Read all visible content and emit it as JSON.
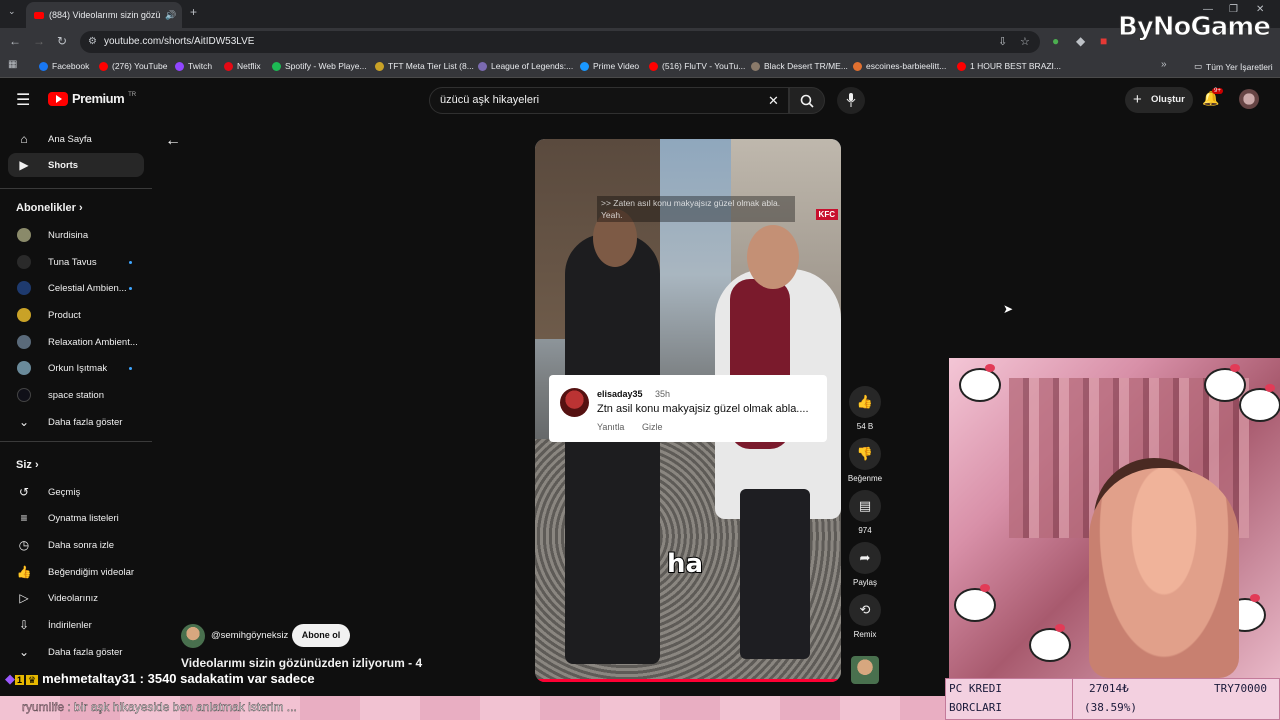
{
  "browser": {
    "tab_title": "(884) Videolarımı sizin gözü",
    "url": "youtube.com/shorts/AitIDW53LVE",
    "bookmarks": [
      "Facebook",
      "(276) YouTube",
      "Twitch",
      "Netflix",
      "Spotify - Web Playe...",
      "TFT Meta Tier List (8...",
      "League of Legends:...",
      "Prime Video",
      "(516) FluTV - YouTu...",
      "Black Desert TR/ME...",
      "escoines-barbieelitt...",
      "1 HOUR BEST BRAZI..."
    ],
    "all_bookmarks": "Tüm Yer İşaretleri"
  },
  "watermark": "ByNoGame",
  "youtube": {
    "logo": "Premium",
    "logo_region": "TR",
    "search_query": "üzücü aşk hikayeleri",
    "create_label": "Oluştur",
    "notif_badge": "9+",
    "sidebar": {
      "home": "Ana Sayfa",
      "shorts": "Shorts",
      "subscriptions_head": "Abonelikler",
      "channels": [
        {
          "name": "Nurdisina",
          "color": "#8a8a6a",
          "dot": false
        },
        {
          "name": "Tuna Tavus",
          "color": "#2a2a2a",
          "dot": true
        },
        {
          "name": "Celestial Ambien...",
          "color": "#1e3a6e",
          "dot": true
        },
        {
          "name": "Product",
          "color": "#c9a227",
          "dot": false
        },
        {
          "name": "Relaxation Ambient...",
          "color": "#5a6a7a",
          "dot": false
        },
        {
          "name": "Orkun Işıtmak",
          "color": "#6a8a9a",
          "dot": true
        },
        {
          "name": "space station",
          "color": "#101018",
          "dot": false
        }
      ],
      "show_more": "Daha fazla göster",
      "you_head": "Siz",
      "you_items": [
        "Geçmiş",
        "Oynatma listeleri",
        "Daha sonra izle",
        "Beğendiğim videolar",
        "Videolarınız",
        "İndirilenler",
        "Daha fazla göster"
      ]
    },
    "short": {
      "caption_top": ">> Zaten asıl konu makyajsız güzel olmak abla. Yeah.",
      "caption_big": "ha",
      "channel": "@semihgöyneksiz",
      "subscribe": "Abone ol",
      "title": "Videolarımı sizin gözünüzden izliyorum - 4",
      "comment": {
        "user": "elisaday35",
        "time": "35h",
        "text": "Ztn asil konu makyajsiz güzel olmak abla....",
        "reply": "Yanıtla",
        "hide": "Gizle"
      },
      "actions": {
        "likes": "54 B",
        "dislike": "Beğenme",
        "comments": "974",
        "share": "Paylaş",
        "remix": "Remix"
      }
    }
  },
  "stream": {
    "chat_line1_user": "mehmetaltay31",
    "chat_line1_text": ": 3540 sadakatim var sadece",
    "chat_line2_user": "ryumlife",
    "chat_line2_text": ": bir aşk hikayeside ben anlatmak isterim ...",
    "stats": {
      "row1_label": "PC KREDI",
      "row1_value": "27014₺",
      "row1_target": "TRY70000",
      "row2_label": "BORCLARI",
      "row2_value": "(38.59%)"
    }
  }
}
